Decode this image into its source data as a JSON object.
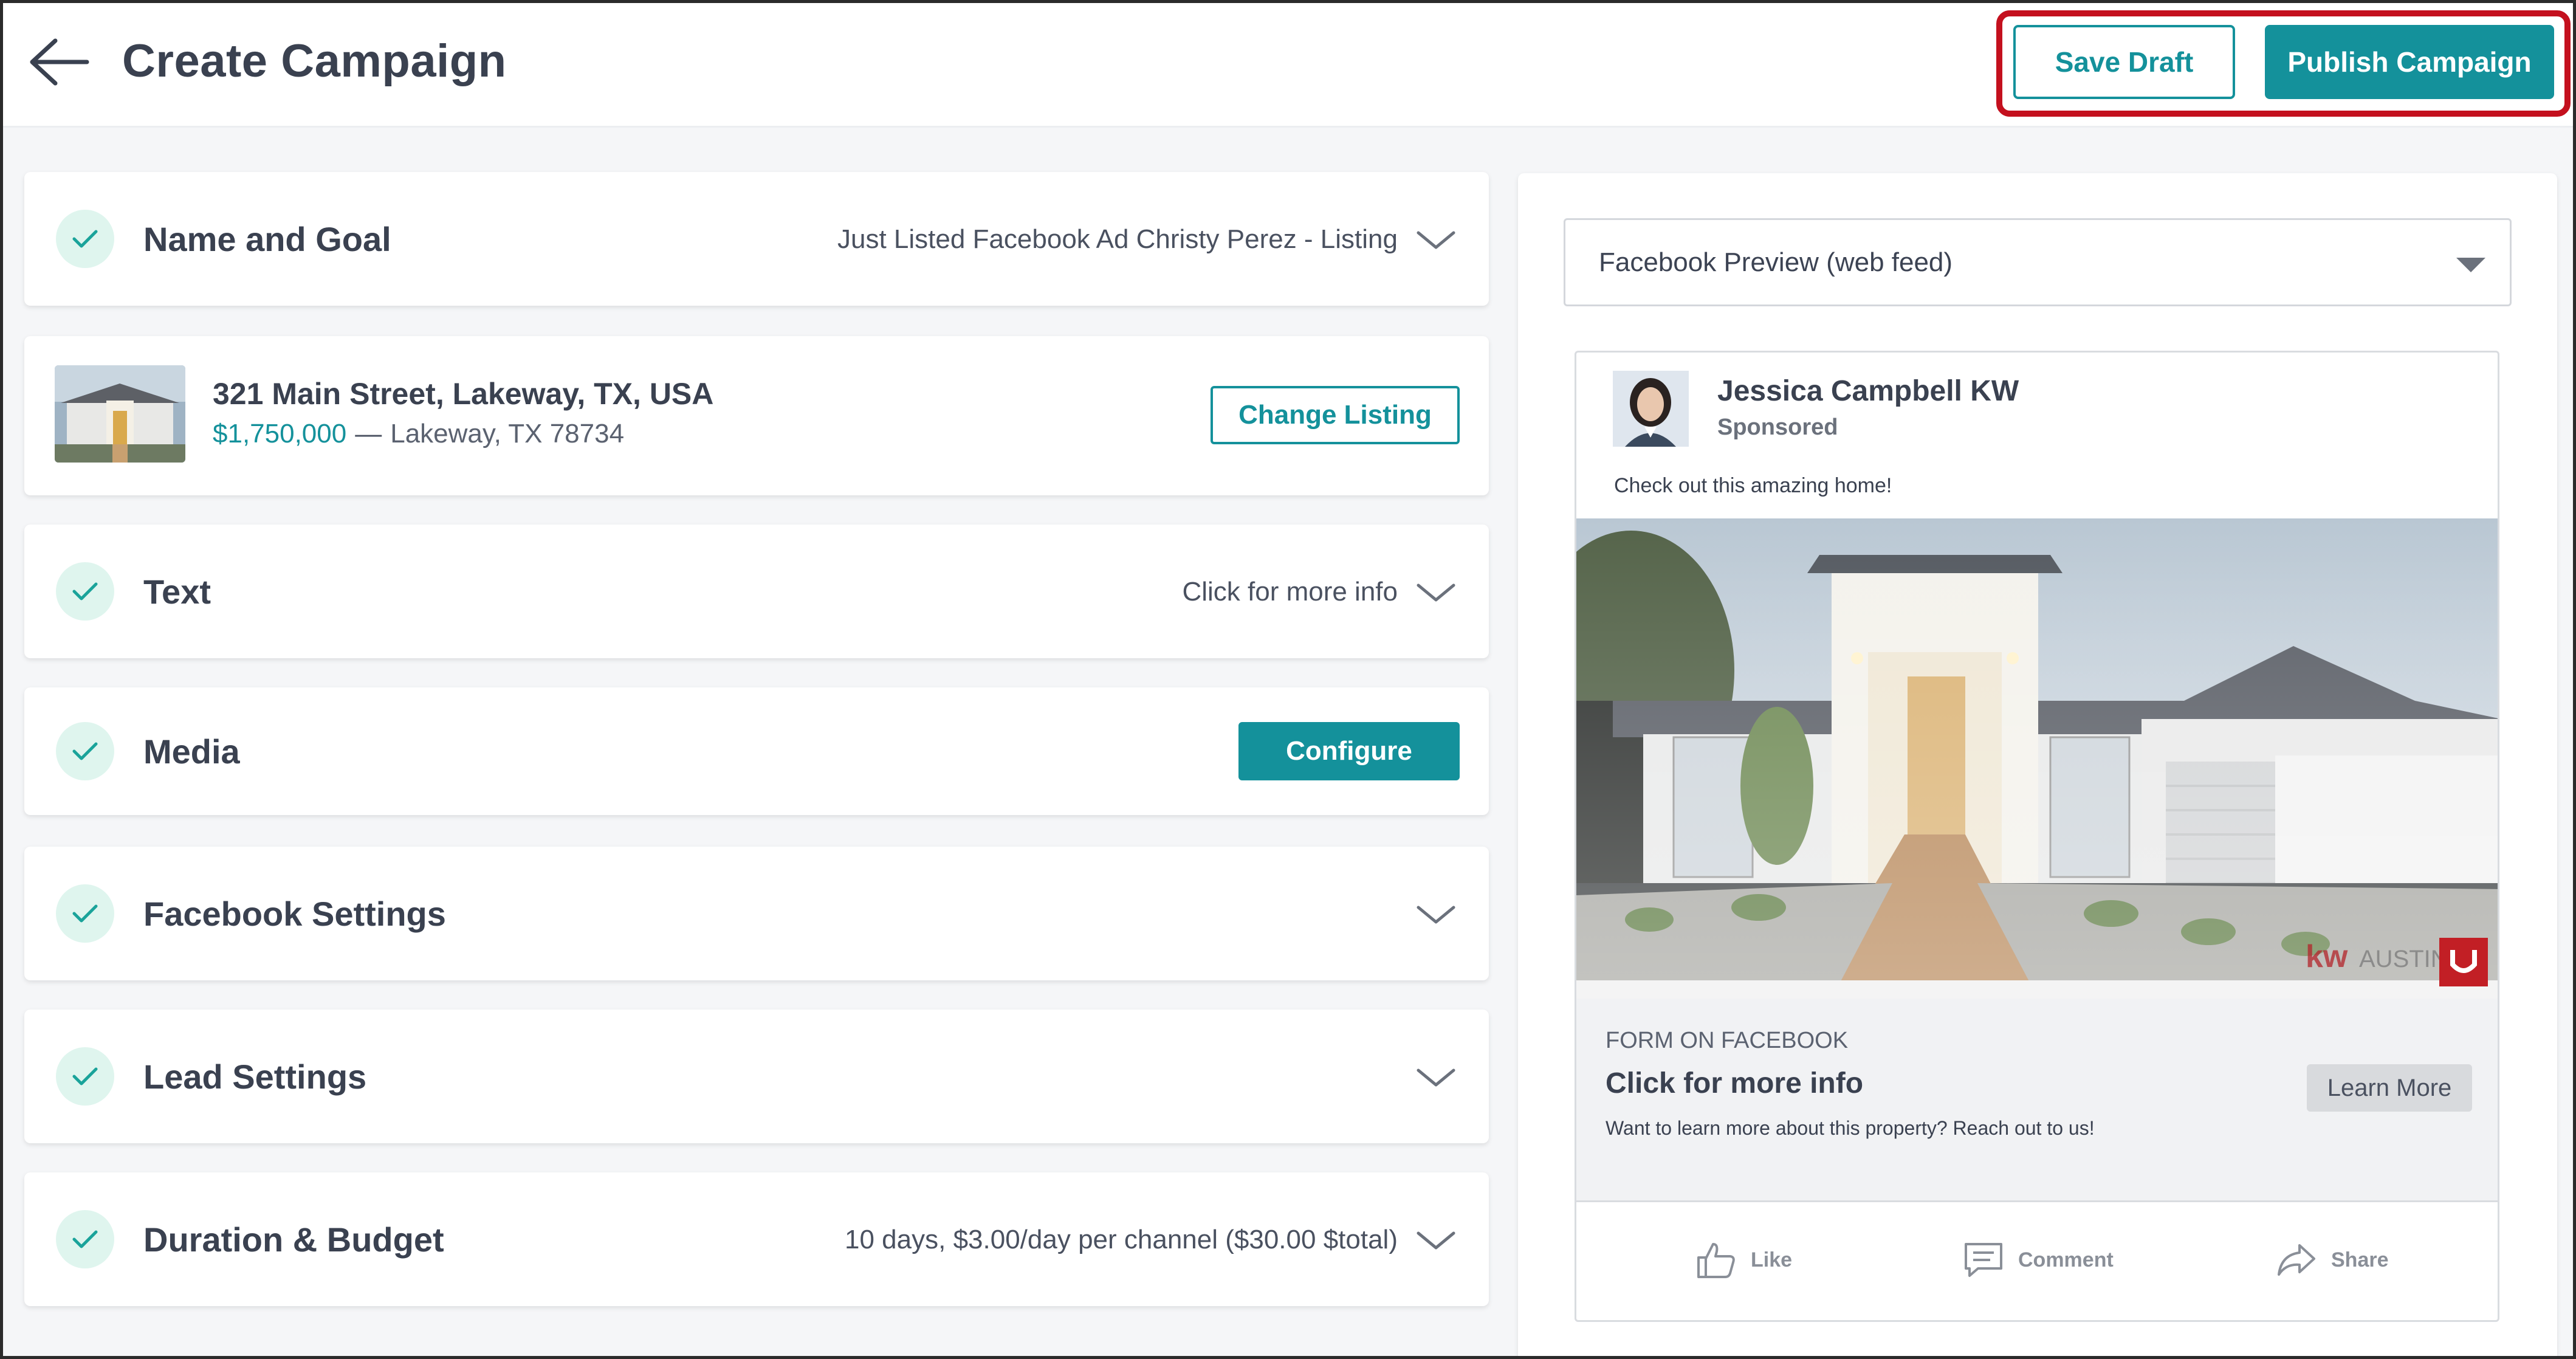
{
  "header": {
    "title": "Create Campaign",
    "save_draft_label": "Save Draft",
    "publish_label": "Publish Campaign"
  },
  "sections": {
    "name_goal": {
      "title": "Name and Goal",
      "summary": "Just Listed Facebook Ad Christy Perez - Listing"
    },
    "listing": {
      "address": "321 Main Street, Lakeway, TX, USA",
      "price": "$1,750,000",
      "separator": "—",
      "location": "Lakeway, TX 78734",
      "button_label": "Change Listing"
    },
    "text": {
      "title": "Text",
      "summary": "Click for more info"
    },
    "media": {
      "title": "Media",
      "button_label": "Configure"
    },
    "facebook_settings": {
      "title": "Facebook Settings"
    },
    "lead_settings": {
      "title": "Lead Settings"
    },
    "duration_budget": {
      "title": "Duration & Budget",
      "summary": "10 days, $3.00/day per channel ($30.00  $total)"
    }
  },
  "preview": {
    "selected": "Facebook Preview (web feed)",
    "ad": {
      "page_name": "Jessica Campbell KW",
      "sponsored": "Sponsored",
      "message": "Check out this amazing home!",
      "form_label": "FORM ON FACEBOOK",
      "headline": "Click for more info",
      "description": "Want to learn more about this property? Reach out to us!",
      "cta_label": "Learn More",
      "like_label": "Like",
      "comment_label": "Comment",
      "share_label": "Share"
    }
  },
  "colors": {
    "accent": "#14919b",
    "highlight": "#c4101e",
    "check_bg": "#dff5ee"
  }
}
